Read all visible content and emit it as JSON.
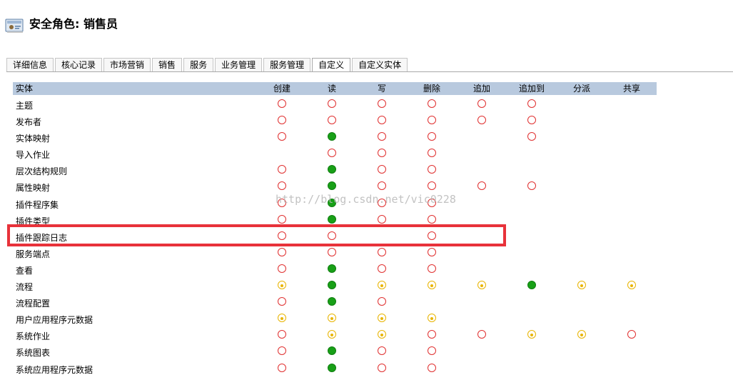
{
  "header": {
    "title": "安全角色: 销售员",
    "icon": "role-card-icon"
  },
  "tabs": [
    {
      "label": "详细信息",
      "active": false
    },
    {
      "label": "核心记录",
      "active": false
    },
    {
      "label": "市场营销",
      "active": false
    },
    {
      "label": "销售",
      "active": false
    },
    {
      "label": "服务",
      "active": false
    },
    {
      "label": "业务管理",
      "active": false
    },
    {
      "label": "服务管理",
      "active": false
    },
    {
      "label": "自定义",
      "active": true
    },
    {
      "label": "自定义实体",
      "active": false
    }
  ],
  "table": {
    "entity_header": "实体",
    "columns": [
      "创建",
      "读",
      "写",
      "删除",
      "追加",
      "追加到",
      "分派",
      "共享"
    ],
    "rows": [
      {
        "name": "主题",
        "levels": [
          "none",
          "none",
          "none",
          "none",
          "none",
          "none",
          "",
          ""
        ]
      },
      {
        "name": "发布者",
        "levels": [
          "none",
          "none",
          "none",
          "none",
          "none",
          "none",
          "",
          ""
        ]
      },
      {
        "name": "实体映射",
        "levels": [
          "none",
          "global",
          "none",
          "none",
          "",
          "none",
          "",
          ""
        ]
      },
      {
        "name": "导入作业",
        "levels": [
          "",
          "none",
          "none",
          "none",
          "",
          "",
          "",
          ""
        ]
      },
      {
        "name": "层次结构规则",
        "levels": [
          "none",
          "global",
          "none",
          "none",
          "",
          "",
          "",
          ""
        ]
      },
      {
        "name": "属性映射",
        "levels": [
          "none",
          "global",
          "none",
          "none",
          "none",
          "none",
          "",
          ""
        ]
      },
      {
        "name": "插件程序集",
        "levels": [
          "none",
          "global",
          "none",
          "none",
          "",
          "",
          "",
          ""
        ]
      },
      {
        "name": "插件类型",
        "levels": [
          "none",
          "global",
          "none",
          "none",
          "",
          "",
          "",
          ""
        ]
      },
      {
        "name": "插件跟踪日志",
        "levels": [
          "none",
          "none",
          "",
          "none",
          "",
          "",
          "",
          ""
        ]
      },
      {
        "name": "服务端点",
        "levels": [
          "none",
          "none",
          "none",
          "none",
          "",
          "",
          "",
          ""
        ]
      },
      {
        "name": "查看",
        "levels": [
          "none",
          "global",
          "none",
          "none",
          "",
          "",
          "",
          ""
        ]
      },
      {
        "name": "流程",
        "levels": [
          "user",
          "global",
          "user",
          "user",
          "user",
          "global",
          "user",
          "user"
        ]
      },
      {
        "name": "流程配置",
        "levels": [
          "none",
          "global",
          "none",
          "",
          "",
          "",
          "",
          ""
        ]
      },
      {
        "name": "用户应用程序元数据",
        "levels": [
          "user",
          "user",
          "user",
          "user",
          "",
          "",
          "",
          ""
        ]
      },
      {
        "name": "系统作业",
        "levels": [
          "none",
          "user",
          "user",
          "none",
          "none",
          "user",
          "user",
          "none"
        ]
      },
      {
        "name": "系统图表",
        "levels": [
          "none",
          "global",
          "none",
          "none",
          "",
          "",
          "",
          ""
        ]
      },
      {
        "name": "系统应用程序元数据",
        "levels": [
          "none",
          "global",
          "none",
          "none",
          "",
          "",
          "",
          ""
        ]
      }
    ]
  },
  "watermark": "http://blog.csdn.net/vic0228",
  "colors": {
    "header_bg": "#b8c9de",
    "none_level": "#e03030",
    "global_level": "#18a017",
    "user_level": "#e8b400",
    "highlight_border": "#e8323a"
  }
}
